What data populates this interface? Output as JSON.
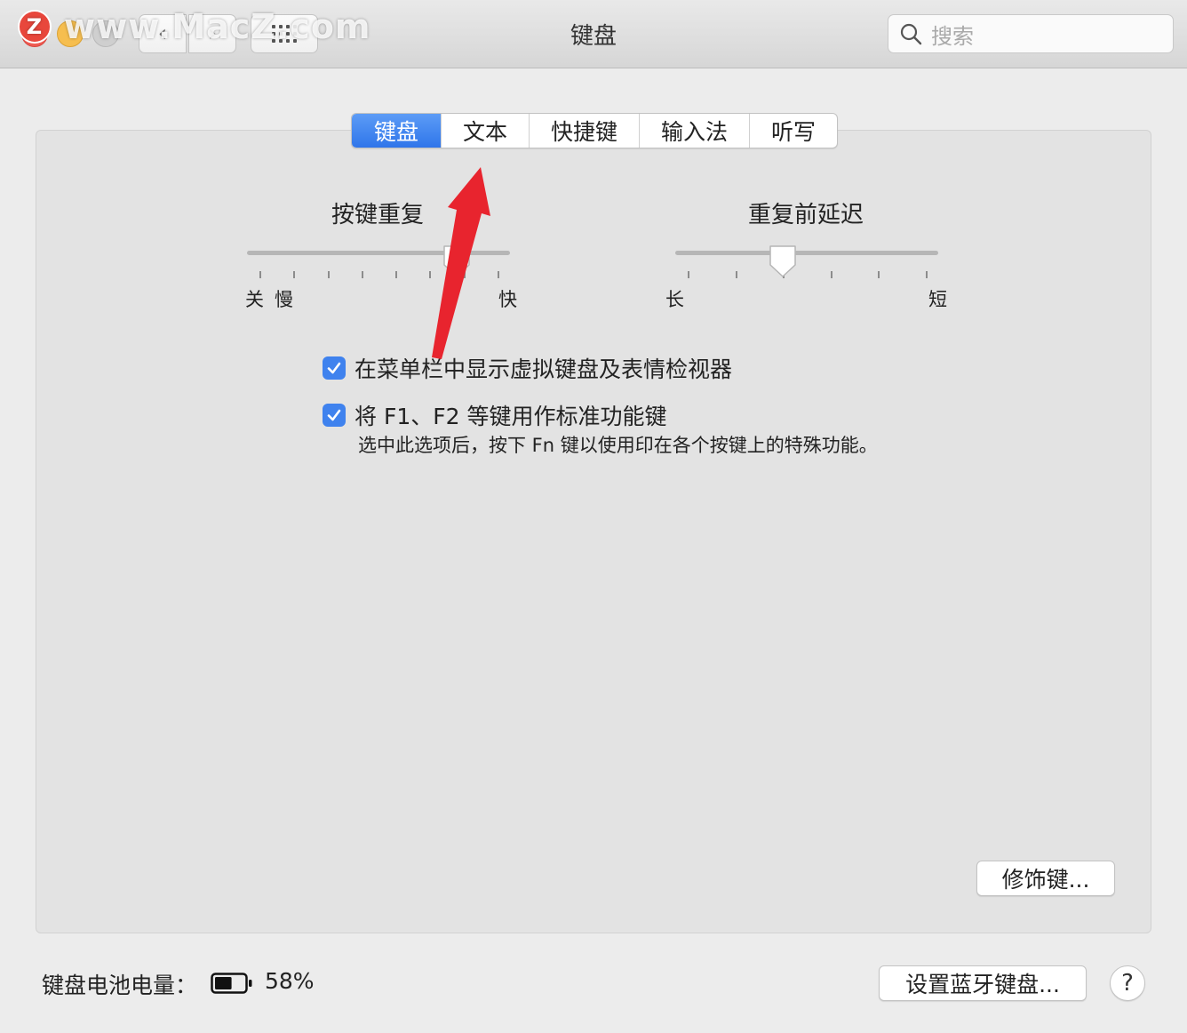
{
  "watermark": {
    "logo": "Z",
    "text": "www.MacZ.com"
  },
  "window": {
    "title": "键盘"
  },
  "search": {
    "placeholder": "搜索"
  },
  "tabs": [
    {
      "label": "键盘",
      "active": true
    },
    {
      "label": "文本",
      "active": false
    },
    {
      "label": "快捷键",
      "active": false
    },
    {
      "label": "输入法",
      "active": false
    },
    {
      "label": "听写",
      "active": false
    }
  ],
  "key_repeat": {
    "title": "按键重复",
    "labels": {
      "off": "关",
      "slow": "慢",
      "fast": "快"
    },
    "level": 0.83
  },
  "delay_until_repeat": {
    "title": "重复前延迟",
    "labels": {
      "long": "长",
      "short": "短"
    },
    "level": 0.4
  },
  "options": {
    "show_viewer": {
      "label": "在菜单栏中显示虚拟键盘及表情检视器",
      "checked": true
    },
    "fn_keys": {
      "label": "将 F1、F2 等键用作标准功能键",
      "checked": true,
      "description": "选中此选项后，按下 Fn 键以使用印在各个按键上的特殊功能。"
    }
  },
  "buttons": {
    "modifier": "修饰键...",
    "bluetooth": "设置蓝牙键盘...",
    "help": "?"
  },
  "battery": {
    "label": "键盘电池电量：",
    "percent": "58%",
    "level": 0.58
  },
  "colors": {
    "accent": "#3f82ee",
    "annotation_arrow": "#e8242e"
  }
}
